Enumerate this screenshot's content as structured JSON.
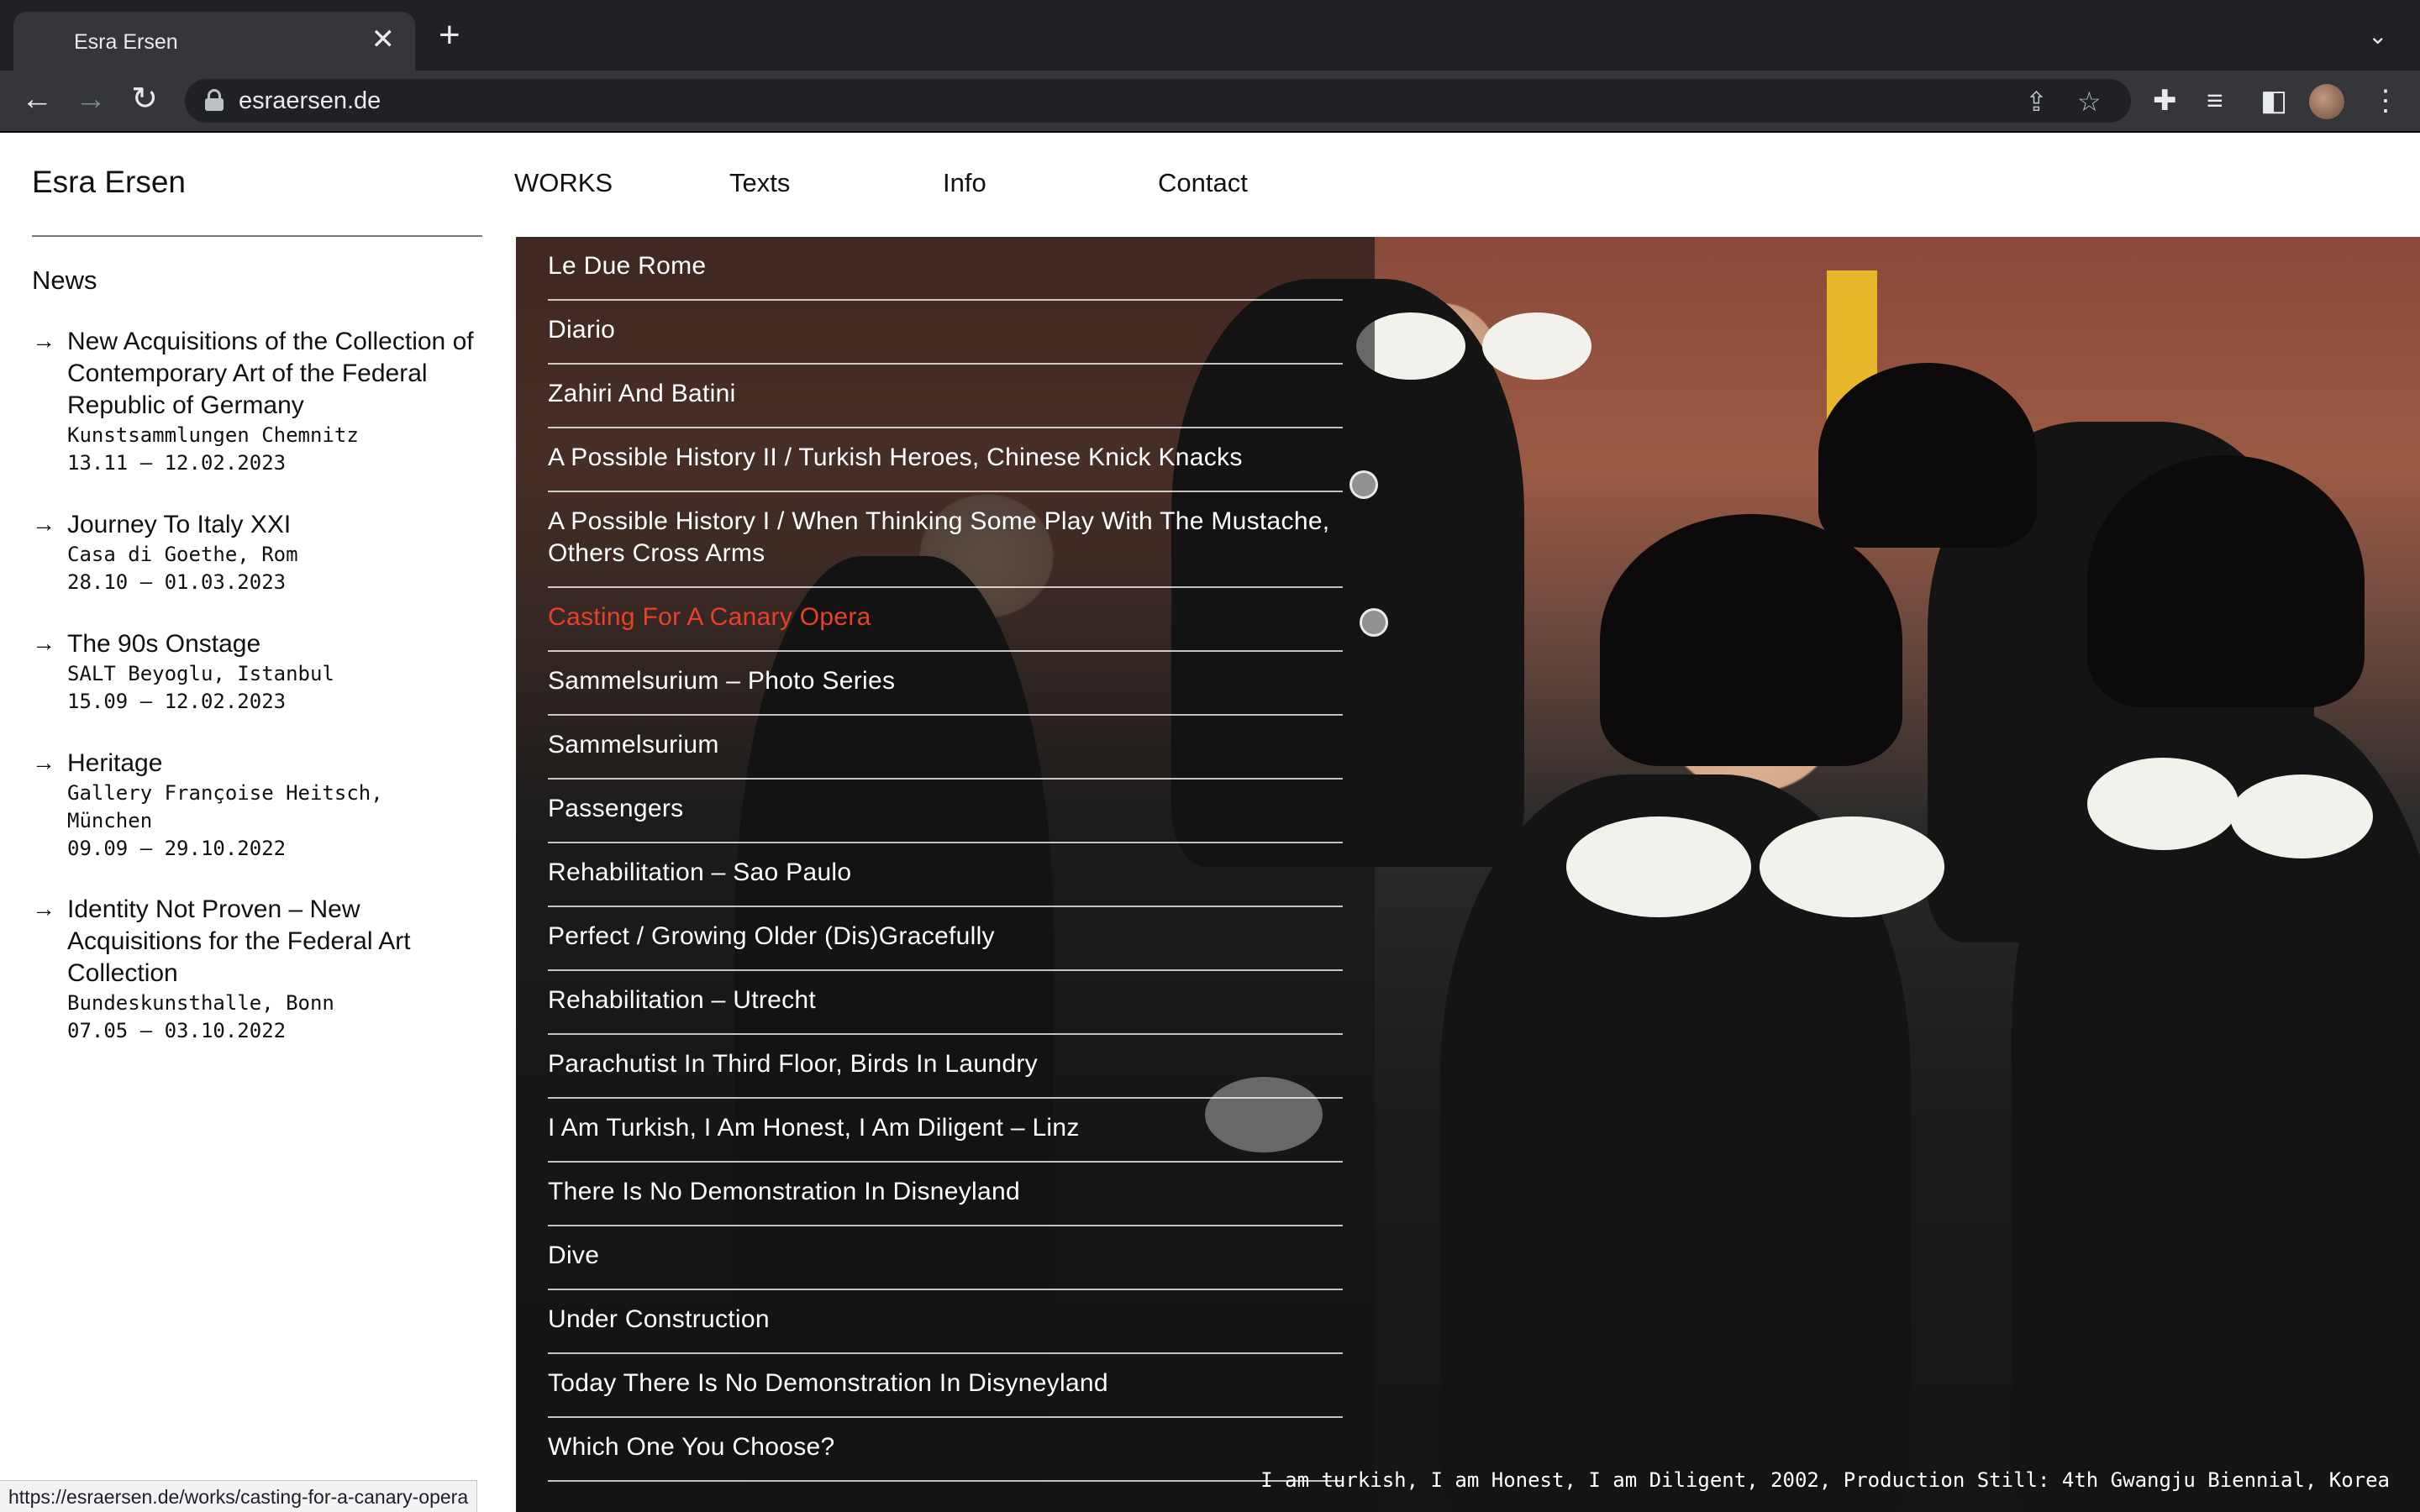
{
  "browser": {
    "tab_title": "Esra Ersen",
    "tab_close": "✕",
    "new_tab": "+",
    "tab_menu": "⌄",
    "url": "esraersen.de",
    "status_url": "https://esraersen.de/works/casting-for-a-canary-opera",
    "icons": {
      "back": "←",
      "forward": "→",
      "reload": "↻",
      "share": "⇪",
      "star": "☆",
      "extensions": "✚",
      "media": "≡",
      "sidepanel": "◧",
      "menu": "⋮"
    }
  },
  "site": {
    "title": "Esra Ersen",
    "nav": [
      "WORKS",
      "Texts",
      "Info",
      "Contact"
    ]
  },
  "news": {
    "heading": "News",
    "arrow": "→",
    "items": [
      {
        "title": "New Acquisitions of the Collection of Contemporary Art of the Federal Republic of Germany",
        "venue": "Kunstsammlungen Chemnitz",
        "dates": "13.11 – 12.02.2023"
      },
      {
        "title": "Journey To Italy XXI",
        "venue": "Casa di Goethe, Rom",
        "dates": "28.10 – 01.03.2023"
      },
      {
        "title": "The 90s Onstage",
        "venue": "SALT Beyoglu, Istanbul",
        "dates": "15.09 – 12.02.2023"
      },
      {
        "title": "Heritage",
        "venue": "Gallery Françoise Heitsch, München",
        "dates": "09.09 – 29.10.2022"
      },
      {
        "title": "Identity Not Proven – New Acquisitions for the Federal Art Collection",
        "venue": "Bundeskunsthalle, Bonn",
        "dates": "07.05 – 03.10.2022"
      }
    ]
  },
  "works": {
    "active_index": 5,
    "items": [
      "Le Due Rome",
      "Diario",
      "Zahiri And Batini",
      "A Possible History II / Turkish Heroes, Chinese Knick Knacks",
      "A Possible History I / When Thinking Some Play With The Mustache, Others Cross Arms",
      "Casting For A Canary Opera",
      "Sammelsurium – Photo Series",
      "Sammelsurium",
      "Passengers",
      "Rehabilitation – Sao Paulo",
      "Perfect / Growing Older (Dis)Gracefully",
      "Rehabilitation – Utrecht",
      "Parachutist In Third Floor, Birds In Laundry",
      "I Am Turkish, I Am Honest, I Am Diligent – Linz",
      "There Is No Demonstration In Disneyland",
      "Dive",
      "Under Construction",
      "Today There Is No Demonstration In Disyneyland",
      "Which One You Choose?"
    ]
  },
  "caption": "I am turkish, I am Honest, I am Diligent, 2002, Production Still: 4th Gwangju Biennial, Korea",
  "colors": {
    "active_work": "#e8412a",
    "chrome_dark": "#202124",
    "chrome_toolbar": "#35363a"
  }
}
